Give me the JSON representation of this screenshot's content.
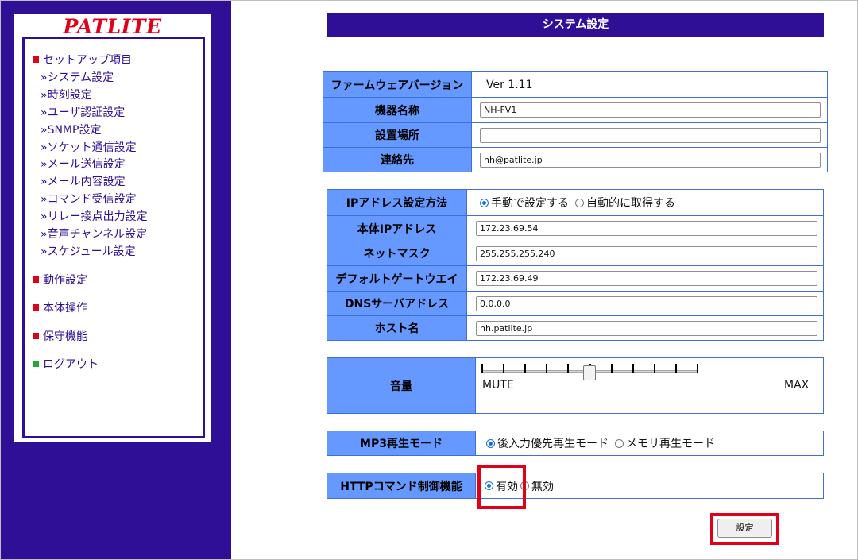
{
  "sidebar": {
    "logo": "PATLITE",
    "setup_heading": "セットアップ項目",
    "setup_items": [
      "»システム設定",
      "»時刻設定",
      "»ユーザ認証設定",
      "»SNMP設定",
      "»ソケット通信設定",
      "»メール送信設定",
      "»メール内容設定",
      "»コマンド受信設定",
      "»リレー接点出力設定",
      "»音声チャンネル設定",
      "»スケジュール設定"
    ],
    "sections": [
      "動作設定",
      "本体操作",
      "保守機能"
    ],
    "logout": "ログアウト",
    "colors": {
      "background": "#2e0f96",
      "bullet": "#e0001a",
      "logout_bullet": "#1fa83a"
    }
  },
  "page": {
    "title": "システム設定",
    "device_info": {
      "firmware_label": "ファームウェアバージョン",
      "firmware_value": "Ver 1.11",
      "device_name_label": "機器名称",
      "device_name_value": "NH-FV1",
      "location_label": "設置場所",
      "location_value": "",
      "contact_label": "連絡先",
      "contact_value": "nh@patlite.jp"
    },
    "network": {
      "ip_method_label": "IPアドレス設定方法",
      "ip_method_options": [
        "手動で設定する",
        "自動的に取得する"
      ],
      "ip_method_selected": "手動で設定する",
      "ip_label": "本体IPアドレス",
      "ip_value": "172.23.69.54",
      "netmask_label": "ネットマスク",
      "netmask_value": "255.255.255.240",
      "gateway_label": "デフォルトゲートウエイ",
      "gateway_value": "172.23.69.49",
      "dns_label": "DNSサーバアドレス",
      "dns_value": "0.0.0.0",
      "host_label": "ホスト名",
      "host_value": "nh.patlite.jp"
    },
    "volume": {
      "label": "音量",
      "min_label": "MUTE",
      "max_label": "MAX",
      "level_fraction": 0.5
    },
    "mp3": {
      "label": "MP3再生モード",
      "options": [
        "後入力優先再生モード",
        "メモリ再生モード"
      ],
      "selected": "後入力優先再生モード"
    },
    "http": {
      "label": "HTTPコマンド制御機能",
      "options": [
        "有効",
        "無効"
      ],
      "selected": "有効"
    },
    "submit_label": "設定",
    "accent_colors": {
      "label_cell": "#6699ff",
      "border": "#3e6fd6",
      "highlight": "#e0001a"
    }
  }
}
